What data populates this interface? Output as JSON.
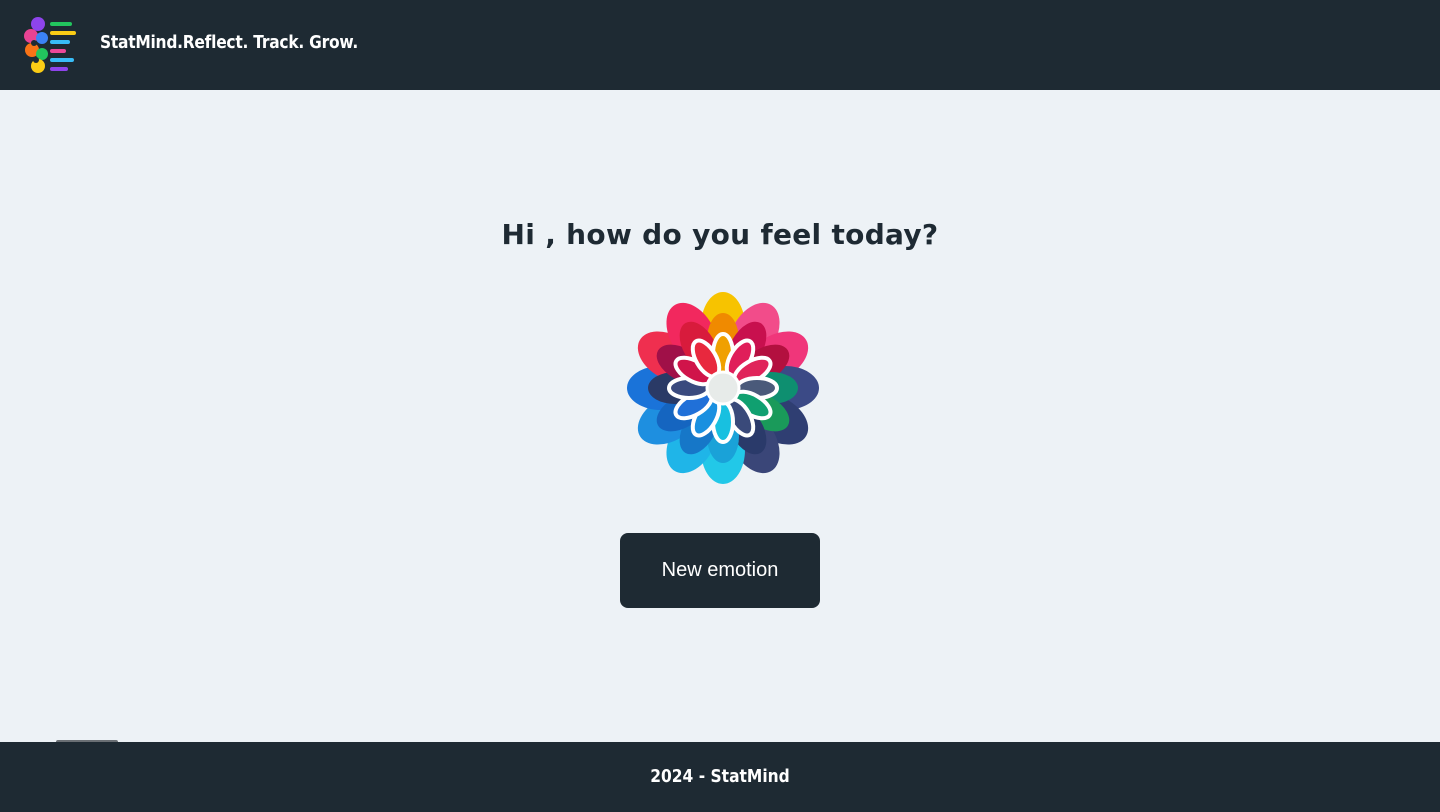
{
  "header": {
    "brand_text": "StatMind.Reflect. Track. Grow.",
    "logo_icon": "brain-lines-logo-icon"
  },
  "main": {
    "greeting": "Hi , how do you feel today?",
    "flower_icon": "emotion-wheel-flower-icon",
    "new_emotion_label": "New emotion"
  },
  "footer": {
    "text": "2024 - StatMind"
  },
  "colors": {
    "dark": "#1e2a33",
    "background": "#edf2f6",
    "text_light": "#ffffff"
  }
}
